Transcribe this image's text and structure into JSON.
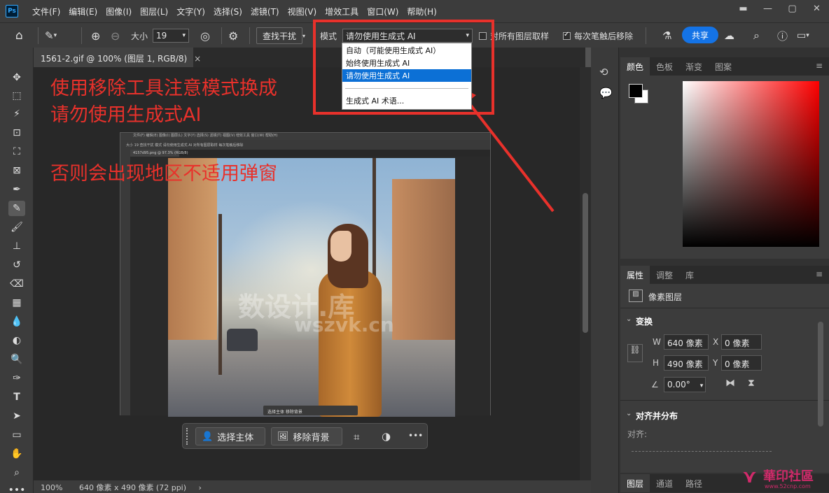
{
  "app": {
    "logo_text": "Ps"
  },
  "menus": [
    "文件(F)",
    "编辑(E)",
    "图像(I)",
    "图层(L)",
    "文字(Y)",
    "选择(S)",
    "滤镜(T)",
    "视图(V)",
    "增效工具",
    "窗口(W)",
    "帮助(H)"
  ],
  "window_controls": {
    "minimize": "—",
    "restore": "▢",
    "close": "✕",
    "extra": "▬"
  },
  "options": {
    "size_label": "大小",
    "size_value": "19",
    "find_button": "查找干扰",
    "mode_label": "模式",
    "mode_value": "请勿使用生成式 AI",
    "sample_all_label": "对所有图层取样",
    "remove_after_label": "每次笔触后移除",
    "share_label": "共享"
  },
  "mode_dropdown": {
    "options": [
      "自动（可能使用生成式 AI）",
      "始终使用生成式 AI",
      "请勿使用生成式 AI"
    ],
    "selected_index": 2,
    "footer": "生成式 AI 术语..."
  },
  "document_tab": {
    "title": "1561-2.gif @ 100% (图层 1, RGB/8)",
    "close": "×"
  },
  "annotations": {
    "line1": "使用移除工具注意模式换成",
    "line2": "请勿使用生成式AI",
    "line3": "否则会出现地区不适用弹窗"
  },
  "watermark": {
    "line1": "数设计.库",
    "line2": "wszvk.cn"
  },
  "inner_screenshot": {
    "menu": "文件(F) 编辑(E) 图像(I) 图层(L) 文字(Y) 选择(S) 滤镜(T) 视图(V) 增效工具 窗口(W) 帮助(H)",
    "options": "大小 19   查找干扰   模式  请勿使用生成式 AI    对所有图层取样    每次笔触后移除",
    "tab": "4157d95.png @ 97.3% (RGB/8)",
    "float": "选择主体   移除背景"
  },
  "floating_bar": {
    "select_subject": "选择主体",
    "remove_bg": "移除背景",
    "more": "•••"
  },
  "status": {
    "zoom": "100%",
    "info": "640 像素 x 490 像素 (72 ppi)",
    "arrow": "›"
  },
  "color_panel": {
    "tabs": [
      "颜色",
      "色板",
      "渐变",
      "图案"
    ],
    "active": 0
  },
  "properties_panel": {
    "tabs": [
      "属性",
      "调整",
      "库"
    ],
    "layer_type": "像素图层",
    "transform_title": "变换",
    "w_label": "W",
    "w_value": "640 像素",
    "h_label": "H",
    "h_value": "490 像素",
    "x_label": "X",
    "x_value": "0 像素",
    "y_label": "Y",
    "y_value": "0 像素",
    "angle_value": "0.00°",
    "align_title": "对齐并分布",
    "align_label": "对齐:"
  },
  "layers_panel": {
    "tabs": [
      "图层",
      "通道",
      "路径"
    ]
  },
  "site_logo": {
    "name": "華印社區",
    "url": "www.52cnp.com"
  },
  "colors": {
    "accent": "#1473e6",
    "annotation": "#e8312b",
    "selection": "#0c70d6"
  }
}
